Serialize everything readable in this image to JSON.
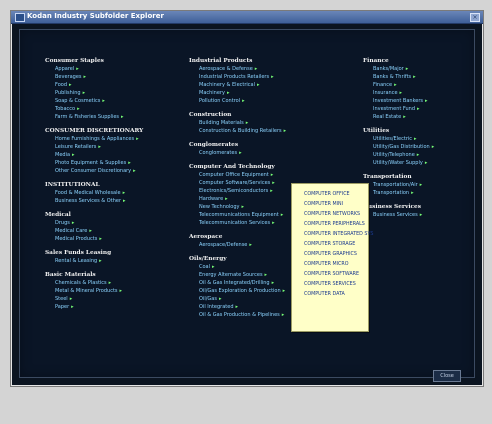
{
  "window": {
    "title": "Kodan Industry Subfolder Explorer",
    "close_label": "×",
    "footer_close_label": "Close"
  },
  "columns": [
    {
      "sections": [
        {
          "title": "Consumer Staples",
          "items": [
            "Apparel",
            "Beverages",
            "Food",
            "Publishing",
            "Soap & Cosmetics",
            "Tobacco",
            "Farm & Fisheries Supplies"
          ]
        },
        {
          "title": "CONSUMER DISCRETIONARY",
          "items": [
            "Home Furnishings & Appliances",
            "Leisure Retailers",
            "Media",
            "Photo Equipment & Supplies",
            "Other Consumer Discretionary"
          ]
        },
        {
          "title": "INSTITUTIONAL",
          "items": [
            "Food & Medical Wholesale",
            "Business Services & Other"
          ]
        },
        {
          "title": "Medical",
          "items": [
            "Drugs",
            "Medical Care",
            "Medical Products"
          ]
        },
        {
          "title": "Sales Funds Leasing",
          "items": [
            "Rental & Leasing"
          ]
        },
        {
          "title": "Basic Materials",
          "items": [
            "Chemicals & Plastics",
            "Metal & Mineral Products",
            "Steel",
            "Paper"
          ]
        }
      ]
    },
    {
      "sections": [
        {
          "title": "Industrial Products",
          "items": [
            "Aerospace & Defense",
            "Industrial Products Retailers",
            "Machinery & Electrical",
            "Machinery",
            "Pollution Control"
          ]
        },
        {
          "title": "Construction",
          "items": [
            "Building Materials",
            "Construction & Building Retailers"
          ]
        },
        {
          "title": "Conglomerates",
          "items": [
            "Conglomerates"
          ]
        },
        {
          "title": "Computer And Technology",
          "items": [
            "Computer Office Equipment",
            "Computer Software/Services",
            "Electronics/Semiconductors",
            "Hardware",
            "New Technology",
            "Telecommunications Equipment",
            "Telecommunication Services"
          ]
        },
        {
          "title": "Aerospace",
          "items": [
            "Aerospace/Defense"
          ]
        },
        {
          "title": "Oils/Energy",
          "items": [
            "Coal",
            "Energy Alternate Sources",
            "Oil & Gas Integrated/Drilling",
            "Oil/Gas Exploration & Production",
            "Oil/Gas",
            "Oil Integrated",
            "Oil & Gas Production & Pipelines"
          ]
        }
      ]
    },
    {
      "sections": [
        {
          "title": "Finance",
          "items": [
            "Banks/Major",
            "Banks & Thrifts",
            "Finance",
            "Insurance",
            "Investment Bankers",
            "Investment Fund",
            "Real Estate"
          ]
        },
        {
          "title": "Utilities",
          "items": [
            "Utilities/Electric",
            "Utility/Gas Distribution",
            "Utility/Telephone",
            "Utility/Water Supply"
          ]
        },
        {
          "title": "Transportation",
          "items": [
            "Transportation/Air",
            "Transportation"
          ]
        },
        {
          "title": "Business Services",
          "items": [
            "Business Services"
          ]
        }
      ]
    }
  ],
  "popup": {
    "items": [
      "COMPUTER OFFICE",
      "COMPUTER MINI",
      "COMPUTER NETWORKS",
      "COMPUTER PERIPHERALS",
      "COMPUTER INTEGRATED SYS",
      "COMPUTER STORAGE",
      "COMPUTER GRAPHICS",
      "COMPUTER MICRO",
      "COMPUTER SOFTWARE",
      "COMPUTER SERVICES",
      "COMPUTER DATA"
    ]
  },
  "colors": {
    "link": "#8cd4ff",
    "arrow": "#77ff77",
    "heading": "#f2f2f2",
    "background": "#0a1526",
    "popup": "#ffffc8"
  }
}
